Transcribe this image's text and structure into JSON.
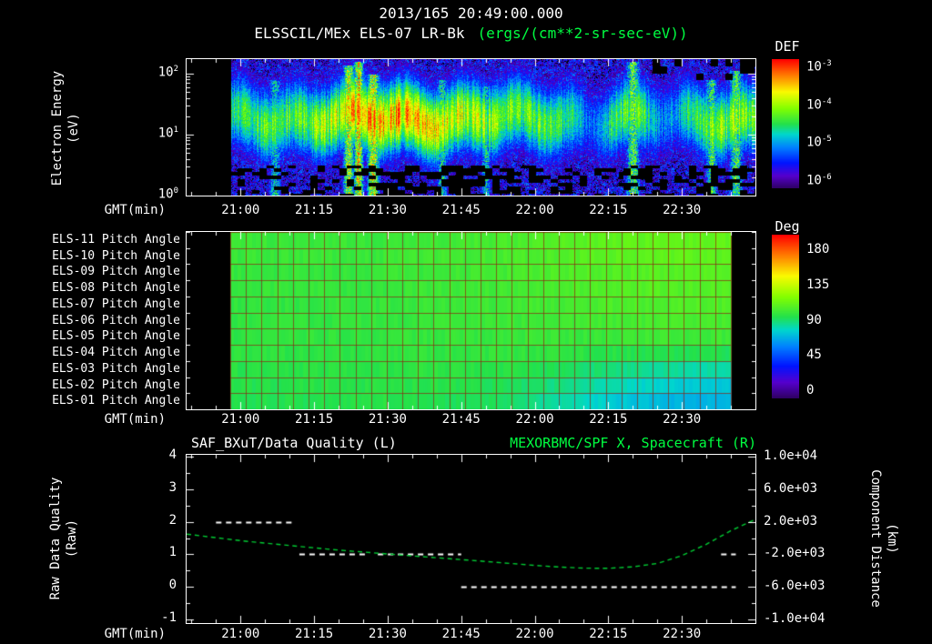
{
  "meta": {
    "datetime_title": "2013/165 20:49:00.000"
  },
  "colors": {
    "foreground": "#ffffff",
    "accent_green": "#00ff41",
    "background": "#000000",
    "pitch_grid": "rgba(140,40,20,0.7)",
    "quality_line": "#ffffff",
    "orbit_line": "#00cc33"
  },
  "time_axis": {
    "label": "GMT(min)",
    "start": "20:49",
    "end": "22:45",
    "major_ticks": [
      "21:00",
      "21:15",
      "21:30",
      "21:45",
      "22:00",
      "22:15",
      "22:30"
    ],
    "minor_step_min": 5
  },
  "chart_data": [
    {
      "id": "electron-spectrogram",
      "type": "heatmap",
      "title": "ELSSCIL/MEx ELS-07 LR-Bk",
      "units_label": "(ergs/(cm**2-sr-sec-eV))",
      "xlabel": "GMT(min)",
      "ylabel_line1": "Electron Energy",
      "ylabel_line2": "(eV)",
      "y_scale": "log",
      "y_ticks": [
        "10^0",
        "10^1",
        "10^2"
      ],
      "ylim_log": [
        0,
        2.24
      ],
      "colorbar": {
        "label": "DEF",
        "ticks": [
          "10^-3",
          "10^-4",
          "10^-5",
          "10^-6"
        ],
        "exp_range": [
          -6,
          -3
        ]
      },
      "data_start": "20:58",
      "data_end": "22:45",
      "band": {
        "center_log_ev": 1.27,
        "sigma_log": 0.42,
        "col_times": [
          "20:58",
          "21:02",
          "21:06",
          "21:10",
          "21:14",
          "21:18",
          "21:22",
          "21:26",
          "21:30",
          "21:34",
          "21:38",
          "21:42",
          "21:46",
          "21:50",
          "21:54",
          "21:58",
          "22:02",
          "22:06",
          "22:10",
          "22:14",
          "22:18",
          "22:22",
          "22:26",
          "22:30",
          "22:34",
          "22:38",
          "22:42",
          "22:45"
        ],
        "peak_exp": [
          -4.5,
          -4.5,
          -4.4,
          -4.4,
          -4.3,
          -4.1,
          -3.8,
          -3.5,
          -3.6,
          -3.7,
          -3.9,
          -4.0,
          -4.1,
          -4.2,
          -4.3,
          -4.4,
          -4.5,
          -4.5,
          -4.6,
          -4.5,
          -4.3,
          -4.5,
          -4.7,
          -4.6,
          -4.4,
          -4.3,
          -4.2,
          -4.2
        ]
      },
      "streaks": [
        {
          "t": "21:07",
          "peak_exp": -4.6,
          "sigma_min": 1.0,
          "top_log": 1.9
        },
        {
          "t": "21:22",
          "peak_exp": -3.6,
          "sigma_min": 0.8,
          "top_log": 2.15
        },
        {
          "t": "21:24",
          "peak_exp": -3.3,
          "sigma_min": 0.7,
          "top_log": 2.2
        },
        {
          "t": "21:27",
          "peak_exp": -3.5,
          "sigma_min": 0.9,
          "top_log": 2.0
        },
        {
          "t": "21:41",
          "peak_exp": -4.4,
          "sigma_min": 0.8,
          "top_log": 1.9
        },
        {
          "t": "21:50",
          "peak_exp": -4.5,
          "sigma_min": 0.7,
          "top_log": 1.8
        },
        {
          "t": "22:20",
          "peak_exp": -4.0,
          "sigma_min": 1.0,
          "top_log": 2.2
        },
        {
          "t": "22:36",
          "peak_exp": -4.2,
          "sigma_min": 0.9,
          "top_log": 1.9
        },
        {
          "t": "22:41",
          "peak_exp": -4.1,
          "sigma_min": 1.0,
          "top_log": 2.05
        }
      ],
      "gaps": [
        {
          "t": "22:12",
          "depth": 0.45,
          "sigma_min": 2.0
        },
        {
          "t": "22:27",
          "depth": 0.3,
          "sigma_min": 2.5
        }
      ]
    },
    {
      "id": "pitch-angle",
      "type": "heatmap",
      "xlabel": "GMT(min)",
      "colorbar": {
        "label": "Deg",
        "ticks": [
          180,
          135,
          90,
          45,
          0
        ],
        "range": [
          0,
          180
        ]
      },
      "data_start": "20:58",
      "data_end": "22:40",
      "grid_cols": 32,
      "rows": [
        {
          "label": "ELS-11 Pitch Angle",
          "values": [
            95,
            95,
            95,
            95,
            95,
            96,
            97,
            98,
            100,
            102,
            103,
            104,
            104,
            104
          ]
        },
        {
          "label": "ELS-10 Pitch Angle",
          "values": [
            95,
            95,
            95,
            95,
            95,
            96,
            97,
            98,
            99,
            101,
            102,
            103,
            103,
            103
          ]
        },
        {
          "label": "ELS-09 Pitch Angle",
          "values": [
            94,
            94,
            94,
            94,
            95,
            95,
            96,
            97,
            99,
            100,
            101,
            102,
            102,
            102
          ]
        },
        {
          "label": "ELS-08 Pitch Angle",
          "values": [
            94,
            94,
            94,
            94,
            94,
            95,
            96,
            97,
            98,
            99,
            100,
            101,
            101,
            101
          ]
        },
        {
          "label": "ELS-07 Pitch Angle",
          "values": [
            93,
            93,
            93,
            94,
            94,
            95,
            95,
            96,
            97,
            98,
            99,
            99,
            100,
            100
          ]
        },
        {
          "label": "ELS-06 Pitch Angle",
          "values": [
            93,
            93,
            93,
            93,
            94,
            94,
            95,
            95,
            96,
            97,
            97,
            98,
            98,
            98
          ]
        },
        {
          "label": "ELS-05 Pitch Angle",
          "values": [
            92,
            92,
            93,
            93,
            93,
            94,
            94,
            94,
            95,
            95,
            95,
            96,
            96,
            96
          ]
        },
        {
          "label": "ELS-04 Pitch Angle",
          "values": [
            92,
            92,
            92,
            92,
            93,
            93,
            93,
            93,
            93,
            92,
            91,
            90,
            90,
            89
          ]
        },
        {
          "label": "ELS-03 Pitch Angle",
          "values": [
            91,
            91,
            91,
            92,
            92,
            92,
            92,
            91,
            90,
            87,
            84,
            82,
            80,
            79
          ]
        },
        {
          "label": "ELS-02 Pitch Angle",
          "values": [
            90,
            90,
            91,
            91,
            91,
            91,
            90,
            89,
            86,
            82,
            78,
            75,
            73,
            72
          ]
        },
        {
          "label": "ELS-01 Pitch Angle",
          "values": [
            90,
            90,
            90,
            91,
            91,
            90,
            89,
            87,
            83,
            78,
            73,
            70,
            68,
            67
          ]
        }
      ]
    },
    {
      "id": "quality-and-orbit",
      "type": "line",
      "title_left": "SAF_BXuT/Data Quality (L)",
      "title_right": "MEXORBMC/SPF X, Spacecraft (R)",
      "xlabel": "GMT(min)",
      "ylabel_left_line1": "Raw Data Quality",
      "ylabel_left_line2": "(Raw)",
      "ylabel_right_line1": "Component Distance",
      "ylabel_right_line2": "(km)",
      "y_left_ticks": [
        4,
        3,
        2,
        1,
        0,
        -1
      ],
      "ylim_left": [
        -1,
        4
      ],
      "y_right_ticks": [
        "1.0e+04",
        "6.0e+03",
        "2.0e+03",
        "-2.0e+03",
        "-6.0e+03",
        "-1.0e+04"
      ],
      "ylim_right_km": [
        -10000,
        10000
      ],
      "series": [
        {
          "name": "SAF_BXuT/Data Quality",
          "axis": "left",
          "style": "dashed",
          "color": "#ffffff",
          "segments": [
            {
              "start": "20:55",
              "end": "21:11",
              "value": 2
            },
            {
              "start": "21:12",
              "end": "21:26",
              "value": 1
            },
            {
              "start": "21:28",
              "end": "21:45",
              "value": 1
            },
            {
              "start": "21:45",
              "end": "22:41",
              "value": 0
            },
            {
              "start": "22:38",
              "end": "22:41",
              "value": 1
            }
          ]
        },
        {
          "name": "MEXORBMC/SPF X, Spacecraft",
          "axis": "right",
          "style": "dashed",
          "color": "#00cc33",
          "points": [
            {
              "t": "20:49",
              "km": 480
            },
            {
              "t": "21:00",
              "km": -320
            },
            {
              "t": "21:10",
              "km": -920
            },
            {
              "t": "21:20",
              "km": -1480
            },
            {
              "t": "21:30",
              "km": -1960
            },
            {
              "t": "21:40",
              "km": -2420
            },
            {
              "t": "21:50",
              "km": -2880
            },
            {
              "t": "22:00",
              "km": -3360
            },
            {
              "t": "22:05",
              "km": -3560
            },
            {
              "t": "22:10",
              "km": -3700
            },
            {
              "t": "22:15",
              "km": -3720
            },
            {
              "t": "22:20",
              "km": -3540
            },
            {
              "t": "22:25",
              "km": -3120
            },
            {
              "t": "22:30",
              "km": -2160
            },
            {
              "t": "22:35",
              "km": -760
            },
            {
              "t": "22:40",
              "km": 900
            },
            {
              "t": "22:45",
              "km": 2300
            }
          ]
        }
      ]
    }
  ]
}
